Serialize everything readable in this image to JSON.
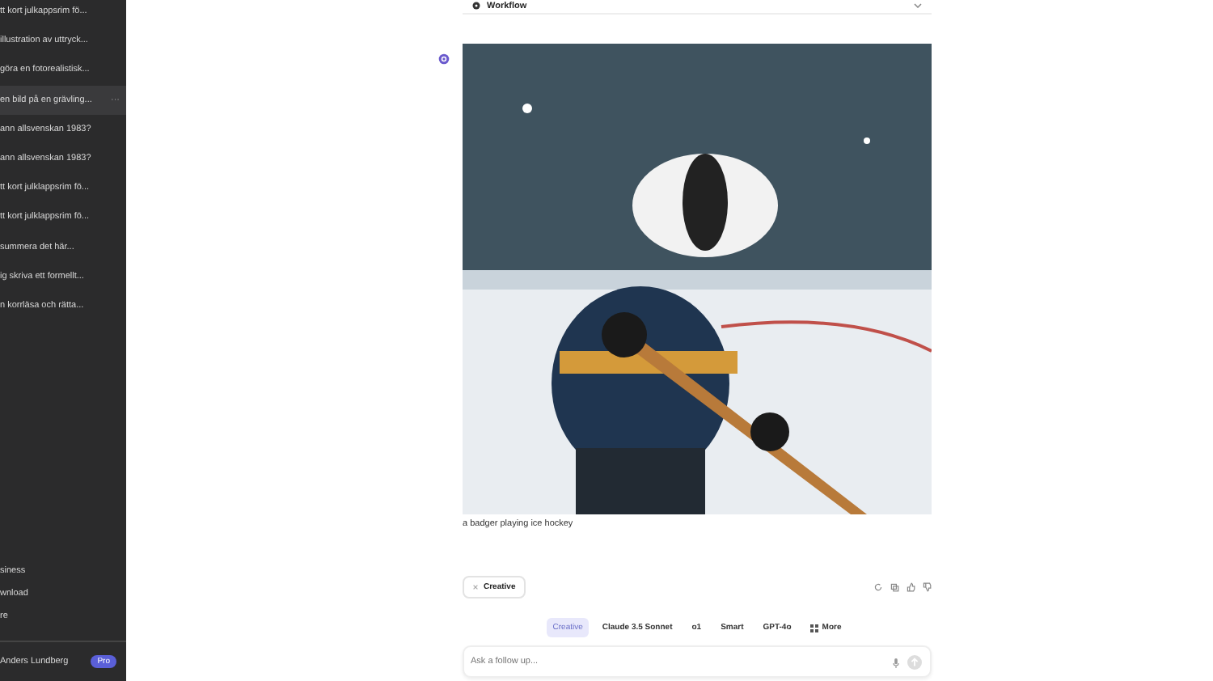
{
  "sidebar": {
    "history": [
      {
        "title": "tt kort julkappsrim fö...",
        "hovered": false
      },
      {
        "title": "illustration av uttryck...",
        "hovered": false
      },
      {
        "title": "göra en fotorealistisk...",
        "hovered": false
      },
      {
        "title": "en bild på en grävling...",
        "hovered": true,
        "menu": "···"
      },
      {
        "title": "ann allsvenskan 1983?",
        "hovered": false
      },
      {
        "title": "ann allsvenskan 1983?",
        "hovered": false
      },
      {
        "title": "tt kort julklappsrim fö...",
        "hovered": false
      },
      {
        "title": "tt kort julklappsrim fö...",
        "hovered": false
      },
      {
        "title": "summera det här...",
        "hovered": false
      },
      {
        "title": "ig skriva ett formellt...",
        "hovered": false
      },
      {
        "title": "n korrläsa och rätta...",
        "hovered": false
      }
    ],
    "links": [
      "siness",
      "wnload",
      "re"
    ],
    "user": {
      "name": "Anders Lundberg",
      "badge": "Pro"
    }
  },
  "main": {
    "workflow": {
      "label": "Workflow"
    },
    "message": {
      "caption": "a badger playing ice hockey",
      "chip": "Creative"
    },
    "models": [
      {
        "label": "Creative",
        "selected": true
      },
      {
        "label": "Claude 3.5 Sonnet",
        "selected": false
      },
      {
        "label": "o1",
        "selected": false
      },
      {
        "label": "Smart",
        "selected": false
      },
      {
        "label": "GPT-4o",
        "selected": false
      },
      {
        "label": "More",
        "selected": false,
        "kind": "more"
      }
    ],
    "input": {
      "placeholder": "Ask a follow up..."
    }
  }
}
